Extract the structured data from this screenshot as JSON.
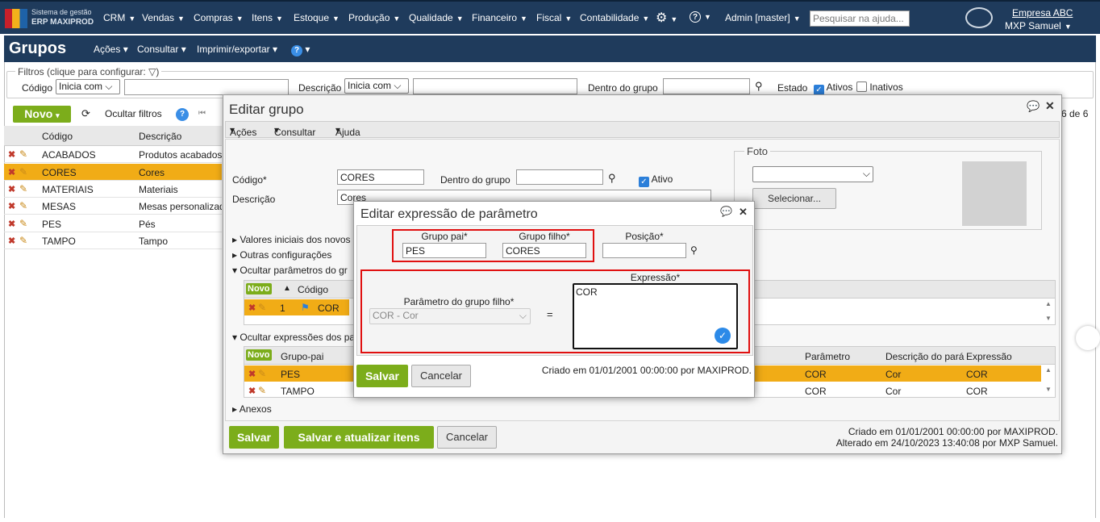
{
  "app": {
    "logo_line1": "Sistema de gestão",
    "logo_line2": "ERP MAXIPROD",
    "search_placeholder": "Pesquisar na ajuda...",
    "company": "Empresa ABC",
    "user": "MXP Samuel",
    "admin": "Admin [master]"
  },
  "menu": [
    "CRM",
    "Vendas",
    "Compras",
    "Itens",
    "Estoque",
    "Produção",
    "Qualidade",
    "Financeiro",
    "Fiscal",
    "Contabilidade"
  ],
  "page": {
    "title": "Grupos",
    "menu": [
      "Ações",
      "Consultar",
      "Imprimir/exportar"
    ]
  },
  "filters": {
    "legend": "Filtros (clique para configurar:",
    "codigo_label": "Código",
    "codigo_mode": "Inicia com",
    "descricao_label": "Descrição",
    "descricao_mode": "Inicia com",
    "dentro_label": "Dentro do grupo",
    "estado_label": "Estado",
    "ativos": "Ativos",
    "inativos": "Inativos"
  },
  "toolbar": {
    "novo": "Novo",
    "ocultar": "Ocultar filtros",
    "pager": "6 de 6"
  },
  "grid": {
    "headers": [
      "Código",
      "Descrição"
    ],
    "rows": [
      {
        "codigo": "ACABADOS",
        "descricao": "Produtos acabados"
      },
      {
        "codigo": "CORES",
        "descricao": "Cores"
      },
      {
        "codigo": "MATERIAIS",
        "descricao": "Materiais"
      },
      {
        "codigo": "MESAS",
        "descricao": "Mesas personalizadas"
      },
      {
        "codigo": "PES",
        "descricao": "Pés"
      },
      {
        "codigo": "TAMPO",
        "descricao": "Tampo"
      }
    ]
  },
  "edit_group": {
    "title": "Editar grupo",
    "menu": [
      "Ações",
      "Consultar",
      "Ajuda"
    ],
    "codigo_label": "Código*",
    "codigo_value": "CORES",
    "dentro_label": "Dentro do grupo",
    "ativo_label": "Ativo",
    "descricao_label": "Descrição",
    "descricao_value": "Cores",
    "foto_label": "Foto",
    "selecionar": "Selecionar...",
    "sec_valores": "Valores iniciais dos novos",
    "sec_outras": "Outras configurações",
    "sec_param": "Ocultar parâmetros do gr",
    "param_headers": [
      "Novo",
      "",
      "Código"
    ],
    "param_row": {
      "n": "1",
      "codigo": "COR"
    },
    "sec_expr": "Ocultar expressões dos pa",
    "expr_headers": [
      "Novo",
      "Grupo-pai",
      "Parâmetro",
      "Descrição do pará",
      "Expressão"
    ],
    "expr_rows": [
      {
        "pai": "PES",
        "param": "COR",
        "desc": "Cor",
        "expr": "COR"
      },
      {
        "pai": "TAMPO",
        "param": "COR",
        "desc": "Cor",
        "expr": "COR"
      }
    ],
    "sec_anexos": "Anexos",
    "salvar": "Salvar",
    "salvar_atualizar": "Salvar e atualizar itens",
    "cancelar": "Cancelar",
    "criado": "Criado em 01/01/2001 00:00:00 por MAXIPROD.",
    "alterado": "Alterado em 24/10/2023 13:40:08 por MXP Samuel."
  },
  "edit_expr": {
    "title": "Editar expressão de parâmetro",
    "grupo_pai_label": "Grupo pai*",
    "grupo_pai": "PES",
    "grupo_filho_label": "Grupo filho*",
    "grupo_filho": "CORES",
    "posicao_label": "Posição*",
    "param_label": "Parâmetro do grupo filho*",
    "param_value": "COR - Cor",
    "equals": "=",
    "expr_label": "Expressão*",
    "expr_value": "COR",
    "salvar": "Salvar",
    "cancelar": "Cancelar",
    "criado": "Criado em 01/01/2001 00:00:00 por MAXIPROD."
  }
}
